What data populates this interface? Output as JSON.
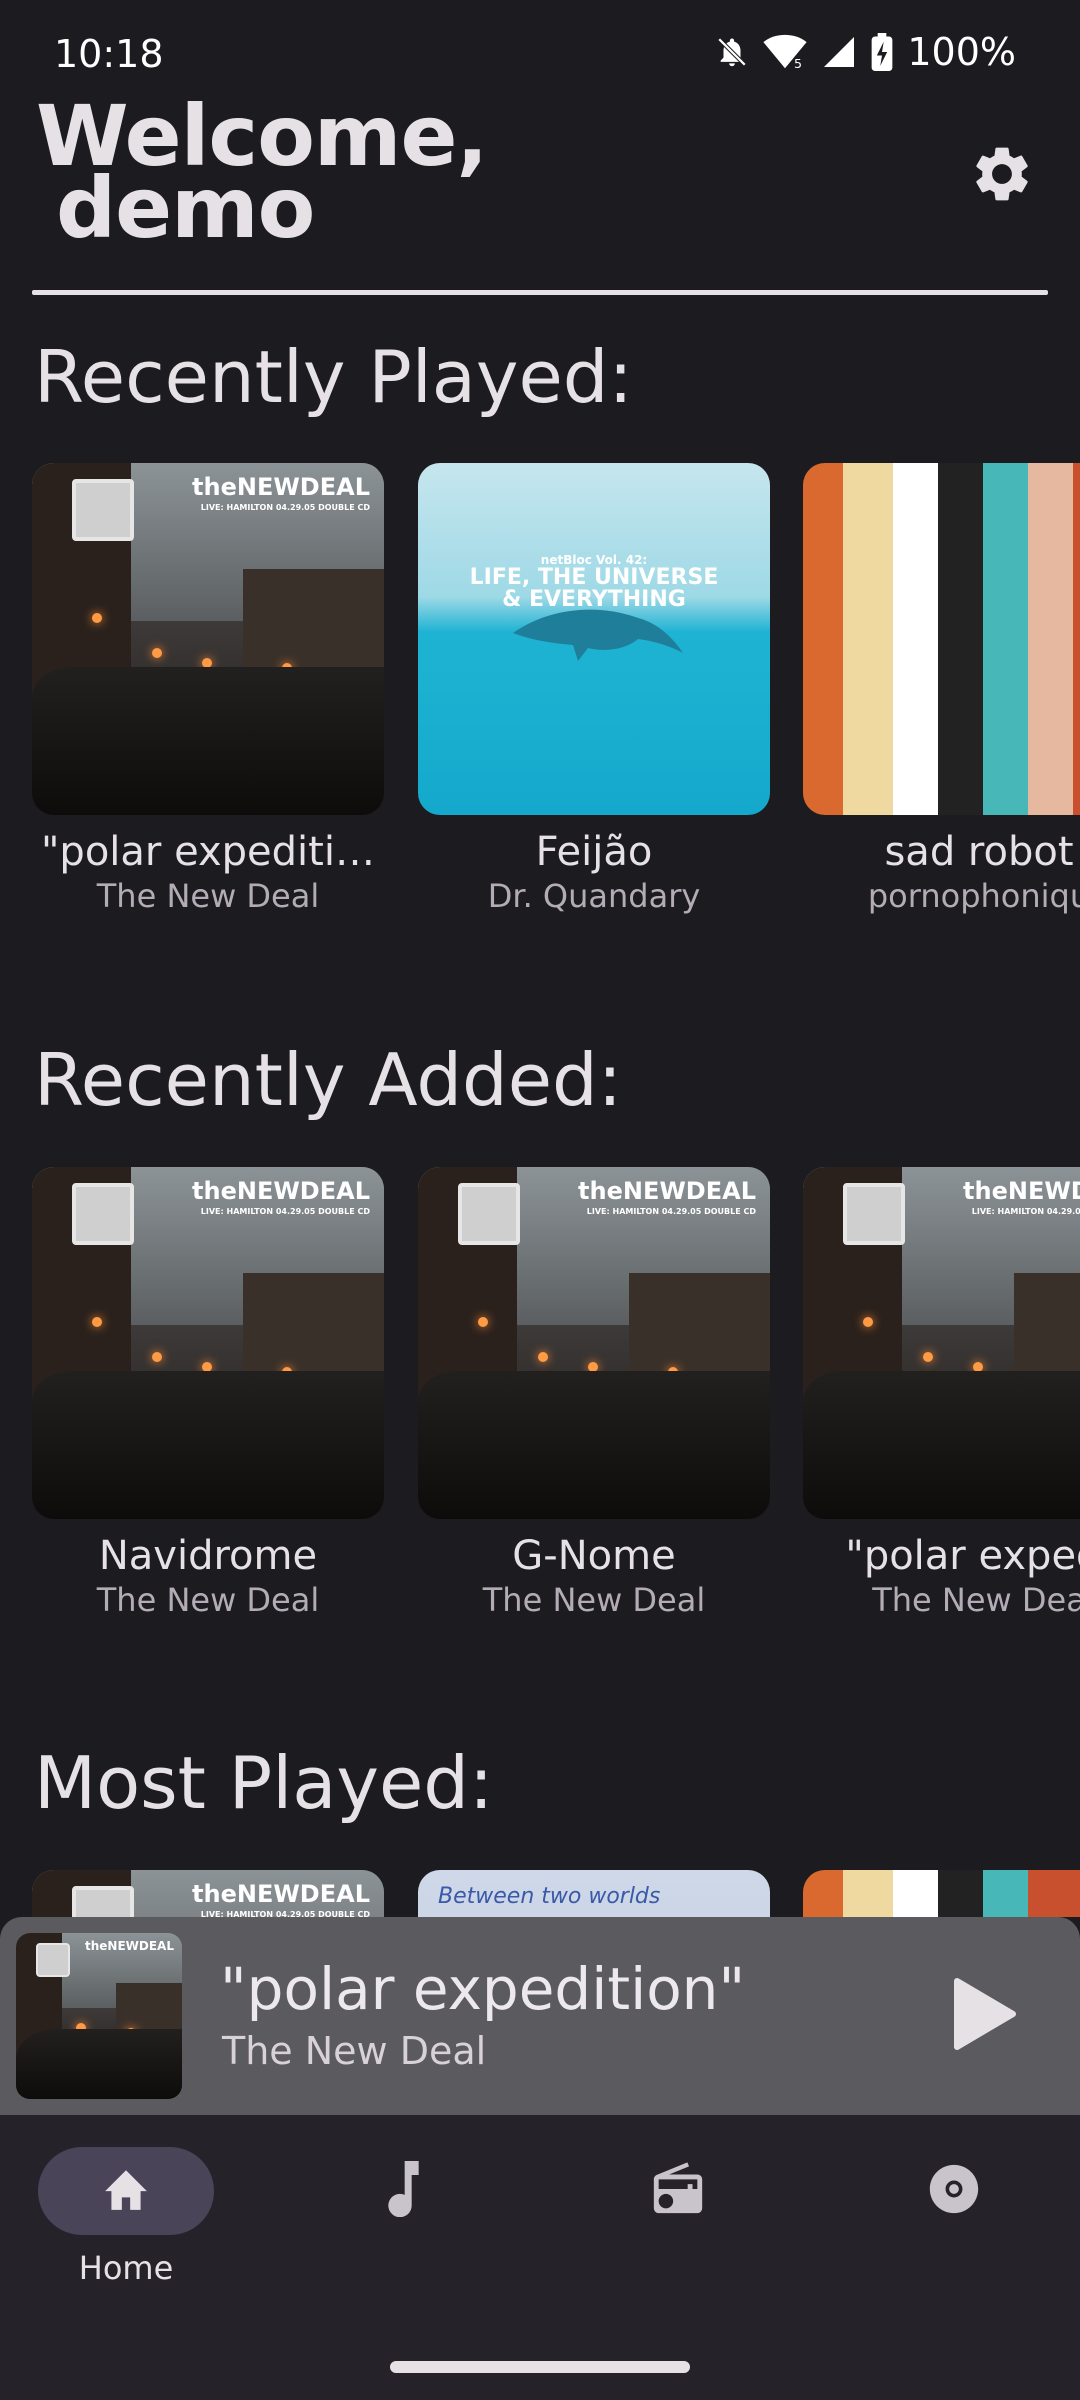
{
  "status_bar": {
    "time": "10:18",
    "battery": "100%",
    "icons": [
      "notifications-off-icon",
      "wifi-icon",
      "signal-icon",
      "battery-charging-icon"
    ]
  },
  "header": {
    "welcome_line1": "Welcome,",
    "welcome_line2": "demo",
    "settings_icon": "gear-icon"
  },
  "sections": {
    "recently_played": {
      "title": "Recently Played:",
      "items": [
        {
          "title": "\"polar expediti…",
          "artist": "The New Deal",
          "cover": "newdeal"
        },
        {
          "title": "Feijão",
          "artist": "Dr. Quandary",
          "cover": "feijao"
        },
        {
          "title": "sad robot",
          "artist": "pornophoniqu",
          "cover": "sadrobot"
        }
      ]
    },
    "recently_added": {
      "title": "Recently Added:",
      "items": [
        {
          "title": "Navidrome",
          "artist": "The New Deal",
          "cover": "newdeal"
        },
        {
          "title": "G-Nome",
          "artist": "The New Deal",
          "cover": "newdeal"
        },
        {
          "title": "\"polar expedi",
          "artist": "The New Dea",
          "cover": "newdeal"
        }
      ]
    },
    "most_played": {
      "title": "Most Played:",
      "items": [
        {
          "cover": "newdeal"
        },
        {
          "cover": "between",
          "script_text": "Between two worlds"
        },
        {
          "cover": "sadrobot"
        }
      ]
    }
  },
  "cover_text": {
    "brand": "theNEWDEAL",
    "sub": "LIVE: HAMILTON 04.29.05 DOUBLE CD",
    "feijao_line1": "netBloc Vol. 42:",
    "feijao_line2": "LIFE, THE UNIVERSE",
    "feijao_line3": "& EVERYTHING"
  },
  "now_playing": {
    "title": "\"polar expedition\"",
    "artist": "The New Deal",
    "play_icon": "play-icon"
  },
  "bottom_nav": {
    "items": [
      {
        "label": "Home",
        "icon": "home-icon",
        "active": true
      },
      {
        "label": "",
        "icon": "music-note-icon",
        "active": false
      },
      {
        "label": "",
        "icon": "radio-icon",
        "active": false
      },
      {
        "label": "",
        "icon": "album-icon",
        "active": false
      }
    ]
  },
  "colors": {
    "background": "#1c1b1f",
    "text": "#e6e1e5",
    "secondary_text": "#b3acb7",
    "mini_player": "#5b5a5f",
    "nav_bar": "#252329",
    "nav_active_pill": "#4a4458"
  }
}
